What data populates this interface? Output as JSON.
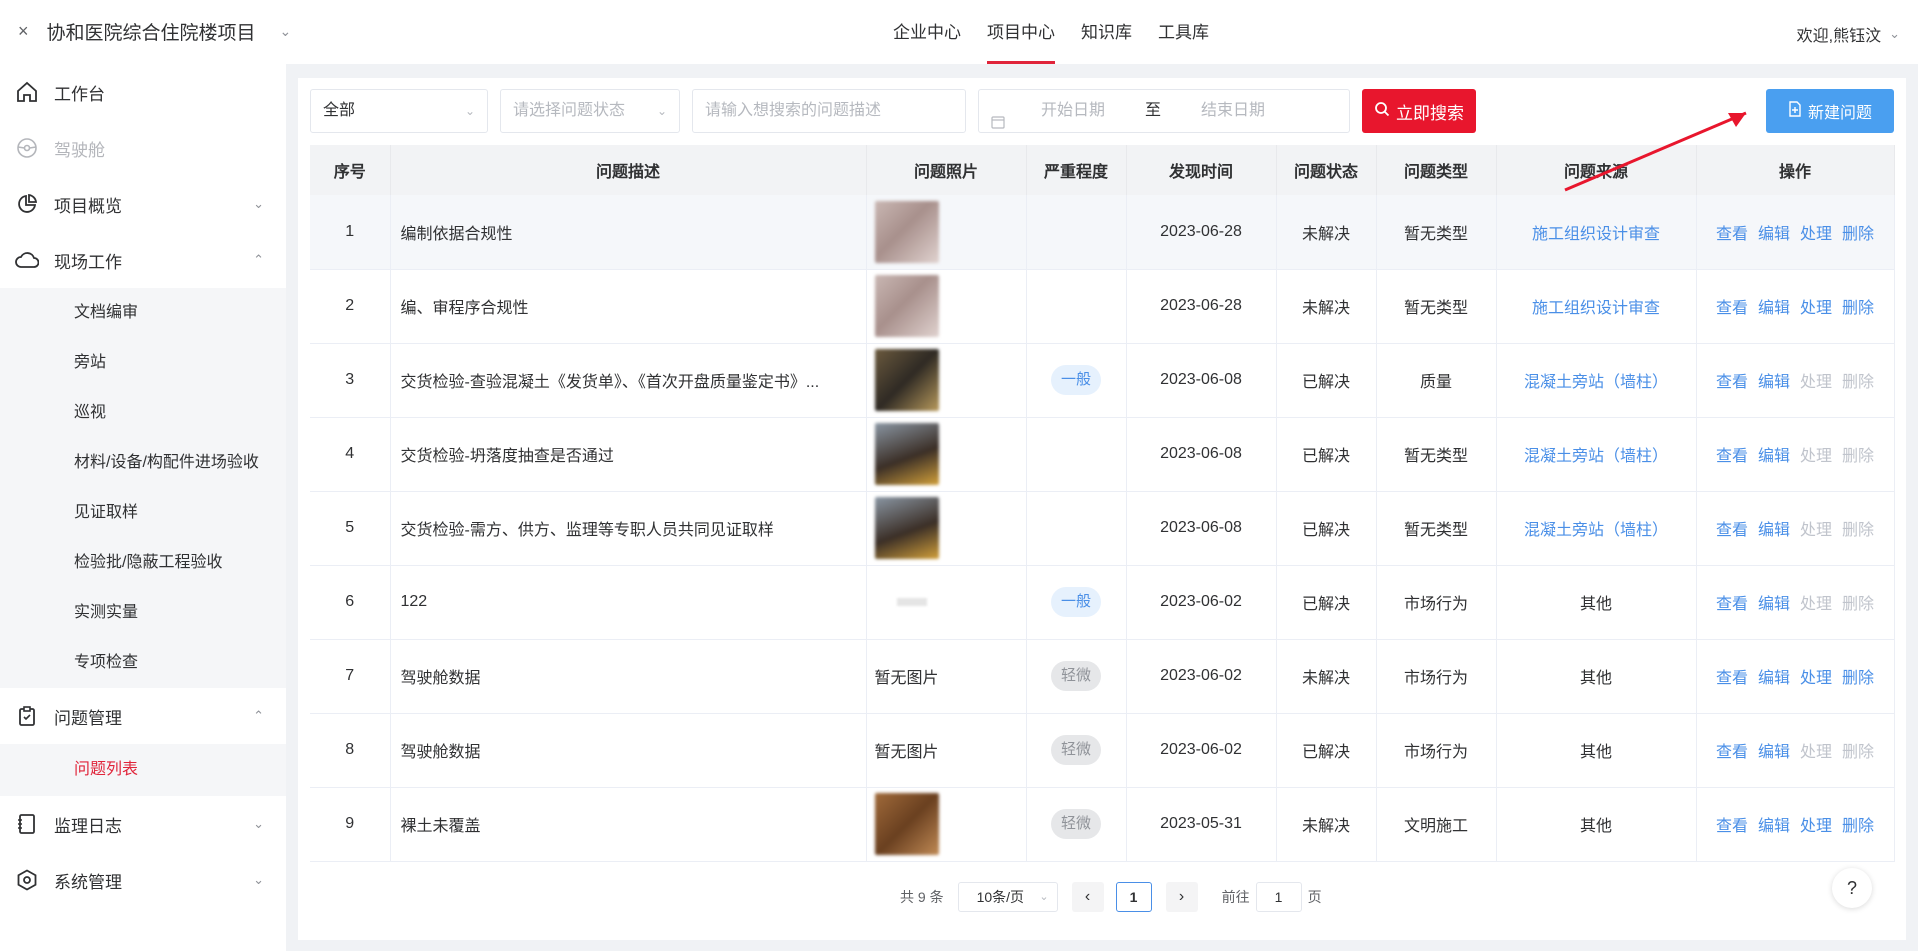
{
  "header": {
    "close": "×",
    "project": "协和医院综合住院楼项目",
    "chevron": "⌄",
    "nav": [
      "企业中心",
      "项目中心",
      "知识库",
      "工具库"
    ],
    "welcome": "欢迎,熊钰汶"
  },
  "sidebar": {
    "items": [
      {
        "label": "工作台",
        "icon": "home-icon"
      },
      {
        "label": "驾驶舱",
        "icon": "steering-icon"
      },
      {
        "label": "项目概览",
        "icon": "pie-chart-icon"
      },
      {
        "label": "现场工作",
        "icon": "cloud-icon"
      },
      {
        "label": "问题管理",
        "icon": "clipboard-icon"
      },
      {
        "label": "监理日志",
        "icon": "log-icon"
      },
      {
        "label": "系统管理",
        "icon": "settings-icon"
      }
    ],
    "field_subitems": [
      "文档编审",
      "旁站",
      "巡视",
      "材料/设备/构配件进场验收",
      "见证取样",
      "检验批/隐蔽工程验收",
      "实测实量",
      "专项检查"
    ],
    "issue_subitems": [
      "问题列表"
    ]
  },
  "filters": {
    "scope": "全部",
    "status_placeholder": "请选择问题状态",
    "desc_placeholder": "请输入想搜索的问题描述",
    "start_placeholder": "开始日期",
    "to": "至",
    "end_placeholder": "结束日期",
    "search_label": "立即搜索",
    "new_label": "新建问题"
  },
  "table": {
    "headers": [
      "序号",
      "问题描述",
      "问题照片",
      "严重程度",
      "发现时间",
      "问题状态",
      "问题类型",
      "问题来源",
      "操作"
    ],
    "ops": [
      "查看",
      "编辑",
      "处理",
      "删除"
    ],
    "rows": [
      {
        "no": "1",
        "desc": "编制依据合规性",
        "photo": "img1",
        "severity": "",
        "date": "2023-06-28",
        "status": "未解决",
        "type": "暂无类型",
        "source": "施工组织设计审查",
        "source_link": true,
        "ops_enabled": [
          true,
          true,
          true,
          true
        ]
      },
      {
        "no": "2",
        "desc": "编、审程序合规性",
        "photo": "img1",
        "severity": "",
        "date": "2023-06-28",
        "status": "未解决",
        "type": "暂无类型",
        "source": "施工组织设计审查",
        "source_link": true,
        "ops_enabled": [
          true,
          true,
          true,
          true
        ]
      },
      {
        "no": "3",
        "desc": "交货检验-查验混凝土《发货单》、《首次开盘质量鉴定书》...",
        "photo": "img2",
        "severity": "一般",
        "date": "2023-06-08",
        "status": "已解决",
        "type": "质量",
        "source": "混凝土旁站（墙柱）",
        "source_link": true,
        "ops_enabled": [
          true,
          true,
          false,
          false
        ]
      },
      {
        "no": "4",
        "desc": "交货检验-坍落度抽查是否通过",
        "photo": "img3",
        "severity": "",
        "date": "2023-06-08",
        "status": "已解决",
        "type": "暂无类型",
        "source": "混凝土旁站（墙柱）",
        "source_link": true,
        "ops_enabled": [
          true,
          true,
          false,
          false
        ]
      },
      {
        "no": "5",
        "desc": "交货检验-需方、供方、监理等专职人员共同见证取样",
        "photo": "img3",
        "severity": "",
        "date": "2023-06-08",
        "status": "已解决",
        "type": "暂无类型",
        "source": "混凝土旁站（墙柱）",
        "source_link": true,
        "ops_enabled": [
          true,
          true,
          false,
          false
        ]
      },
      {
        "no": "6",
        "desc": "122",
        "photo": "small",
        "severity": "一般",
        "date": "2023-06-02",
        "status": "已解决",
        "type": "市场行为",
        "source": "其他",
        "source_link": false,
        "ops_enabled": [
          true,
          true,
          false,
          false
        ]
      },
      {
        "no": "7",
        "desc": "驾驶舱数据",
        "photo": "暂无图片",
        "severity": "轻微",
        "date": "2023-06-02",
        "status": "未解决",
        "type": "市场行为",
        "source": "其他",
        "source_link": false,
        "ops_enabled": [
          true,
          true,
          true,
          true
        ]
      },
      {
        "no": "8",
        "desc": "驾驶舱数据",
        "photo": "暂无图片",
        "severity": "轻微",
        "date": "2023-06-02",
        "status": "已解决",
        "type": "市场行为",
        "source": "其他",
        "source_link": false,
        "ops_enabled": [
          true,
          true,
          false,
          false
        ]
      },
      {
        "no": "9",
        "desc": "裸土未覆盖",
        "photo": "img4",
        "severity": "轻微",
        "date": "2023-05-31",
        "status": "未解决",
        "type": "文明施工",
        "source": "其他",
        "source_link": false,
        "ops_enabled": [
          true,
          true,
          true,
          true
        ]
      }
    ]
  },
  "pager": {
    "total": "共 9 条",
    "size": "10条/页",
    "page": "1",
    "goto_prefix": "前往",
    "goto_value": "1",
    "goto_suffix": "页"
  },
  "help": "?",
  "colors": {
    "accent": "#e8162d",
    "primary": "#4a9ff0",
    "link": "#4a8fe7"
  }
}
